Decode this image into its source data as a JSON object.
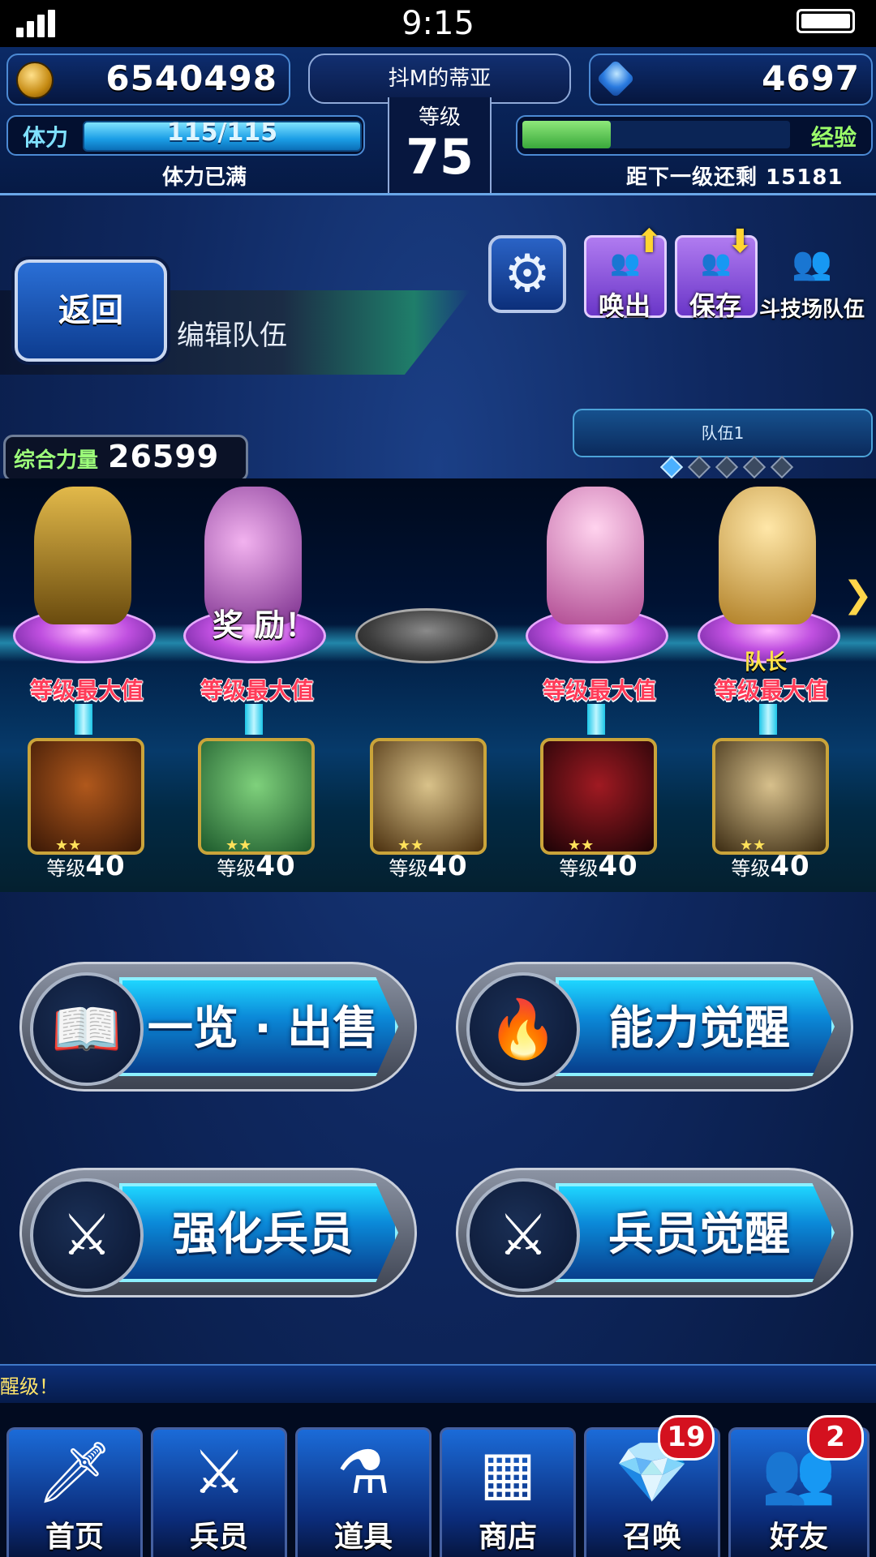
{
  "status_bar": {
    "time": "9:15"
  },
  "hud": {
    "gil": "6540498",
    "gems": "4697",
    "player_name": "抖M的蒂亚",
    "level_label": "等级",
    "level": "75",
    "stamina_label": "体力",
    "stamina_value": "115/115",
    "stamina_fraction": 1.0,
    "stamina_status": "体力已满",
    "exp_label": "经验",
    "exp_fraction": 0.33,
    "exp_remaining": "距下一级还剩 15181"
  },
  "header": {
    "back_label": "返回",
    "title": "编辑队伍",
    "settings_icon": "gear-icon",
    "actions": [
      {
        "label": "唤出",
        "icon": "party-load-icon"
      },
      {
        "label": "保存",
        "icon": "party-save-icon"
      },
      {
        "label": "斗技场队伍",
        "icon": "arena-party-icon"
      }
    ]
  },
  "party": {
    "power_label": "综合力量",
    "power_value": "26599",
    "tab_label": "队伍1",
    "page_count": 5,
    "active_page": 1
  },
  "slots": [
    {
      "status": "等级最大值",
      "bonus": "",
      "leader": "",
      "color": "#c9a02a",
      "esper_color": "#7a3e12",
      "esper_stars": "★★",
      "esper_level_label": "等级",
      "esper_level": "40"
    },
    {
      "status": "等级最大值",
      "bonus": "奖 励！",
      "leader": "",
      "color": "#d58bd9",
      "esper_color": "#3c9c5a",
      "esper_stars": "★★",
      "esper_level_label": "等级",
      "esper_level": "40"
    },
    {
      "status": "",
      "bonus": "",
      "leader": "",
      "color": "",
      "esper_color": "#8a6a2a",
      "esper_stars": "★★",
      "esper_level_label": "等级",
      "esper_level": "40"
    },
    {
      "status": "等级最大值",
      "bonus": "",
      "leader": "",
      "color": "#f2a4d8",
      "esper_color": "#5a0d12",
      "esper_stars": "★★",
      "esper_level_label": "等级",
      "esper_level": "40"
    },
    {
      "status": "等级最大值",
      "bonus": "",
      "leader": "队长",
      "color": "#e8c26a",
      "esper_color": "#6a5a32",
      "esper_stars": "★★",
      "esper_level_label": "等级",
      "esper_level": "40"
    }
  ],
  "menu": [
    {
      "label": "一览 · 出售",
      "icon": "book-icon"
    },
    {
      "label": "能力觉醒",
      "icon": "magic-orbs-icon"
    },
    {
      "label": "强化兵员",
      "icon": "unit-enhance-icon"
    },
    {
      "label": "兵员觉醒",
      "icon": "unit-awaken-icon"
    }
  ],
  "ticker_text": "醒级！",
  "tabs": [
    {
      "label": "首页",
      "icon": "sword-icon",
      "badge": ""
    },
    {
      "label": "兵员",
      "icon": "unit-icon",
      "badge": ""
    },
    {
      "label": "道具",
      "icon": "potion-icon",
      "badge": ""
    },
    {
      "label": "商店",
      "icon": "shop-icon",
      "badge": ""
    },
    {
      "label": "召唤",
      "icon": "crystal-icon",
      "badge": "19"
    },
    {
      "label": "好友",
      "icon": "friends-icon",
      "badge": "2"
    }
  ]
}
